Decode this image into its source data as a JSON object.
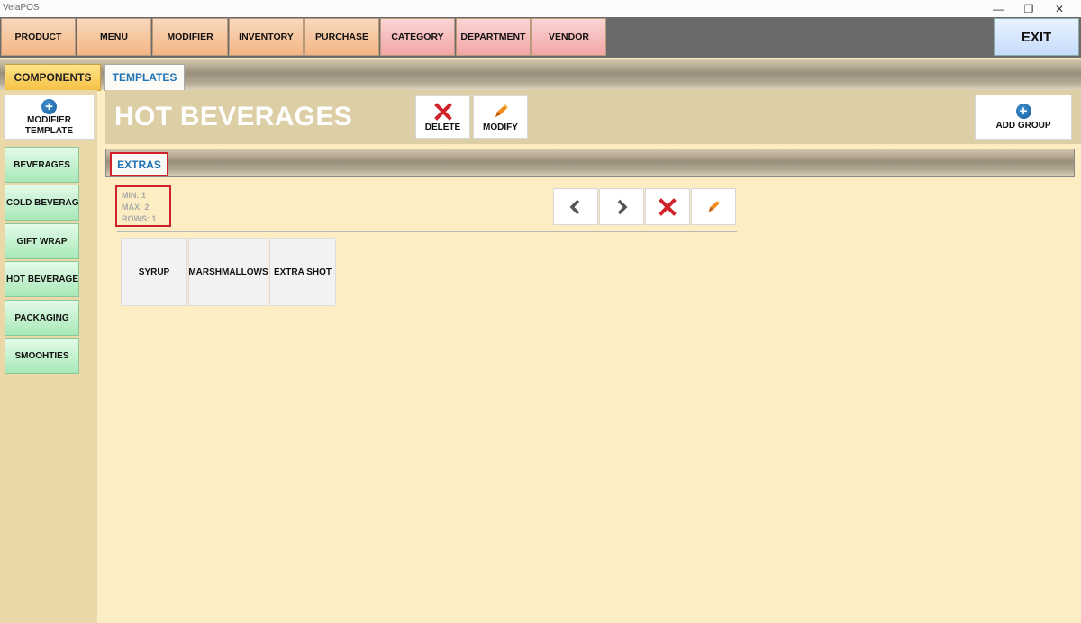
{
  "window": {
    "title": "VelaPOS",
    "minimize": "—",
    "restore": "❐",
    "close": "✕"
  },
  "topnav": {
    "items": [
      "PRODUCT",
      "MENU",
      "MODIFIER",
      "INVENTORY",
      "PURCHASE",
      "CATEGORY",
      "DEPARTMENT",
      "VENDOR"
    ],
    "exit_label": "EXIT"
  },
  "tabs": {
    "active": "COMPONENTS",
    "inactive": "TEMPLATES"
  },
  "sidebar": {
    "modifier_template_label_1": "MODIFIER",
    "modifier_template_label_2": "TEMPLATE",
    "categories": [
      "BEVERAGES",
      "COLD BEVERAGES",
      "GIFT WRAP",
      "HOT BEVERAGES",
      "PACKAGING",
      "SMOOHTIES"
    ]
  },
  "header": {
    "title": "HOT BEVERAGES",
    "delete_label": "DELETE",
    "modify_label": "MODIFY",
    "add_group_label": "ADD GROUP"
  },
  "group": {
    "tab_label": "EXTRAS",
    "min": "MIN: 1",
    "max": "MAX: 2",
    "rows": "ROWS: 1",
    "items": [
      "SYRUP",
      "MARSHMALLOWS",
      "EXTRA SHOT"
    ]
  },
  "colors": {
    "accent_red": "#d0202a",
    "link_blue": "#1f74b8",
    "background": "#fdedc3"
  }
}
